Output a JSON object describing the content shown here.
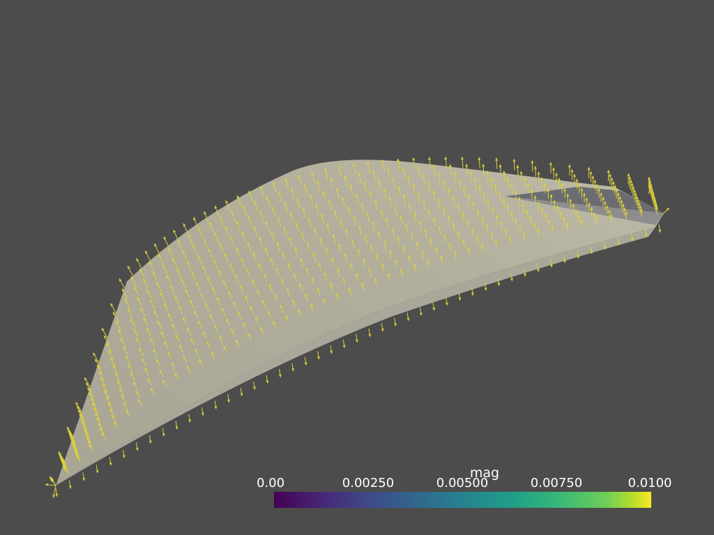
{
  "scene": {
    "background_color": "#4c4c4c",
    "surface_color": "#b3b0a4",
    "glyph_color": "#dcd23a",
    "glyph_type": "arrow-icon"
  },
  "scalar_bar": {
    "title": "mag",
    "colormap": "viridis",
    "range": [
      0.0,
      0.01
    ],
    "ticks": [
      "0.00",
      "0.00250",
      "0.00500",
      "0.00750",
      "0.0100"
    ]
  }
}
